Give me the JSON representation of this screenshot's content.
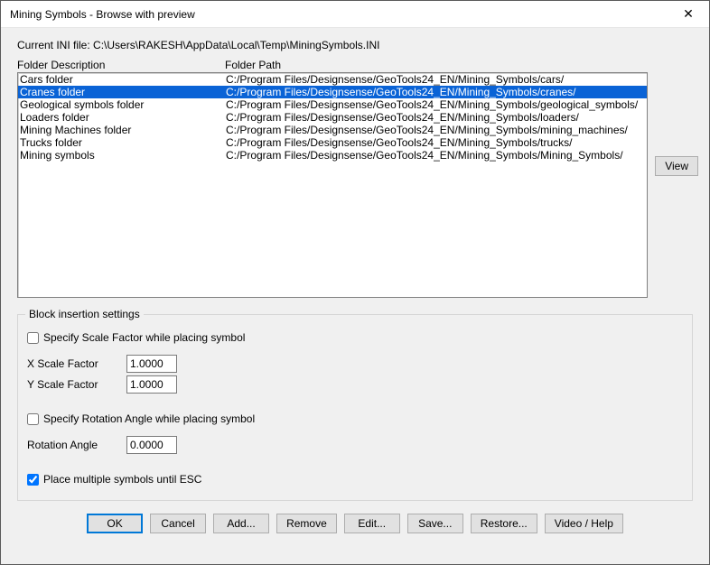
{
  "window": {
    "title": "Mining Symbols - Browse with preview",
    "close_glyph": "✕"
  },
  "ini_line": "Current INI file: C:\\Users\\RAKESH\\AppData\\Local\\Temp\\MiningSymbols.INI",
  "list": {
    "col1_header": "Folder Description",
    "col2_header": "Folder Path",
    "selected_index": 1,
    "rows": [
      {
        "desc": "Cars folder",
        "path": "C:/Program Files/Designsense/GeoTools24_EN/Mining_Symbols/cars/"
      },
      {
        "desc": "Cranes folder",
        "path": "C:/Program Files/Designsense/GeoTools24_EN/Mining_Symbols/cranes/"
      },
      {
        "desc": "Geological symbols folder",
        "path": "C:/Program Files/Designsense/GeoTools24_EN/Mining_Symbols/geological_symbols/"
      },
      {
        "desc": "Loaders folder",
        "path": "C:/Program Files/Designsense/GeoTools24_EN/Mining_Symbols/loaders/"
      },
      {
        "desc": "Mining Machines folder",
        "path": "C:/Program Files/Designsense/GeoTools24_EN/Mining_Symbols/mining_machines/"
      },
      {
        "desc": "Trucks folder",
        "path": "C:/Program Files/Designsense/GeoTools24_EN/Mining_Symbols/trucks/"
      },
      {
        "desc": "Mining symbols",
        "path": "C:/Program Files/Designsense/GeoTools24_EN/Mining_Symbols/Mining_Symbols/"
      }
    ]
  },
  "view_button": "View",
  "group": {
    "legend": "Block insertion settings",
    "specify_scale": {
      "label": "Specify Scale Factor while placing symbol",
      "checked": false
    },
    "x_scale": {
      "label": "X Scale Factor",
      "value": "1.0000"
    },
    "y_scale": {
      "label": "Y Scale Factor",
      "value": "1.0000"
    },
    "specify_rotation": {
      "label": "Specify Rotation Angle while placing symbol",
      "checked": false
    },
    "rotation": {
      "label": "Rotation Angle",
      "value": "0.0000"
    },
    "place_multiple": {
      "label": "Place multiple symbols until ESC",
      "checked": true
    }
  },
  "buttons": {
    "ok": "OK",
    "cancel": "Cancel",
    "add": "Add...",
    "remove": "Remove",
    "edit": "Edit...",
    "save": "Save...",
    "restore": "Restore...",
    "video": "Video / Help"
  }
}
